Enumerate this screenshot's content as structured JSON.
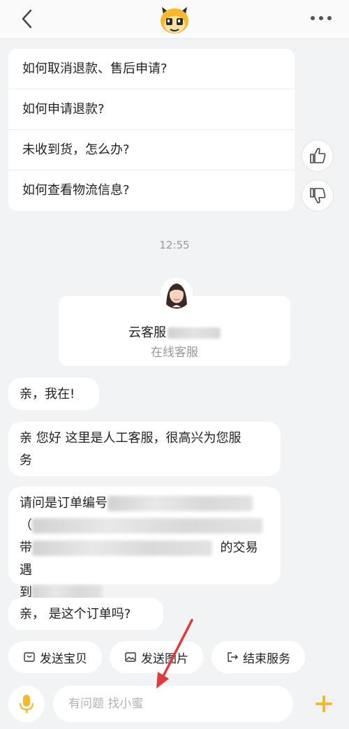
{
  "faq": {
    "items": [
      {
        "label": "如何取消退款、售后申请?"
      },
      {
        "label": "如何申请退款?"
      },
      {
        "label": "未收到货，怎么办?"
      },
      {
        "label": "如何查看物流信息?"
      }
    ]
  },
  "timestamp": "12:55",
  "agent": {
    "name": "云客服",
    "role": "在线客服"
  },
  "messages": {
    "m1": "亲，我在!",
    "m2_line1": "亲  您好   这里是人工客服，很高兴为您服",
    "m2_line2": "务",
    "m3_prefix1": "请问是订单编号",
    "m3_prefix2": "（",
    "m3_prefix3": "带",
    "m3_suffix3": "的交易遇",
    "m3_prefix4": "到",
    "m4": "亲，  是这个订单吗?"
  },
  "quick_actions": {
    "send_item": "发送宝贝",
    "send_image": "发送图片",
    "end_service": "结束服务"
  },
  "input": {
    "placeholder": "有问题 找小蜜"
  },
  "colors": {
    "accent": "#f5b82e",
    "arrow": "#e23a3a",
    "background": "#f2f3f5"
  }
}
